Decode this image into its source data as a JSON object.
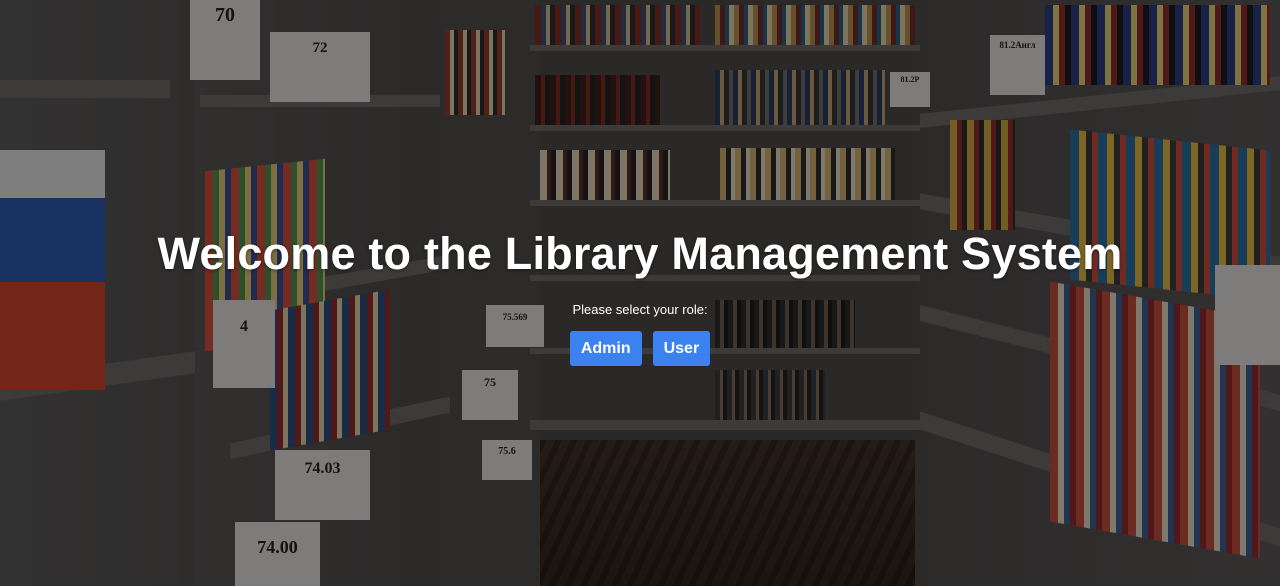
{
  "page": {
    "title": "Welcome to the Library Management System",
    "prompt": "Please select your role:"
  },
  "roles": {
    "admin_label": "Admin",
    "user_label": "User"
  },
  "background": {
    "shelf_labels": [
      "70",
      "72",
      "74.03",
      "74.00",
      "75",
      "75.569",
      "75.6",
      "81.2Англ",
      "81.2Р",
      "4"
    ]
  },
  "colors": {
    "button": "#3b82f0",
    "text": "#ffffff"
  }
}
